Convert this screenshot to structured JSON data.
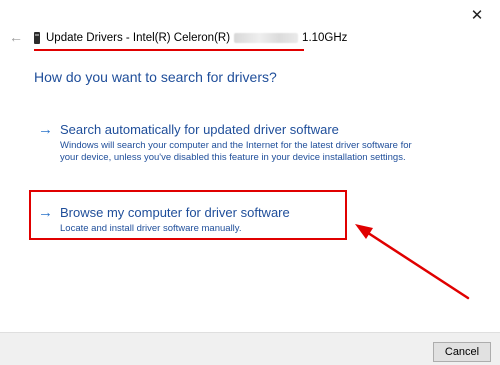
{
  "window": {
    "close_glyph": "✕",
    "back_glyph": "←",
    "title_prefix": "Update Drivers - Intel(R) Celeron(R)",
    "title_suffix": "1.10GHz"
  },
  "main": {
    "question": "How do you want to search for drivers?",
    "options": [
      {
        "arrow": "→",
        "title": "Search automatically for updated driver software",
        "description": "Windows will search your computer and the Internet for the latest driver software for your device, unless you've disabled this feature in your device installation settings."
      },
      {
        "arrow": "→",
        "title": "Browse my computer for driver software",
        "description": "Locate and install driver software manually."
      }
    ]
  },
  "footer": {
    "cancel_label": "Cancel"
  },
  "icons": {
    "close": "close-icon",
    "back": "back-arrow-icon",
    "device": "device-chip-icon",
    "option_arrow": "right-arrow-icon"
  },
  "colors": {
    "link_blue": "#1f4e9a",
    "arrow_blue": "#2a72c9",
    "annotation_red": "#e00000",
    "footer_bg": "#f0f0f0"
  }
}
